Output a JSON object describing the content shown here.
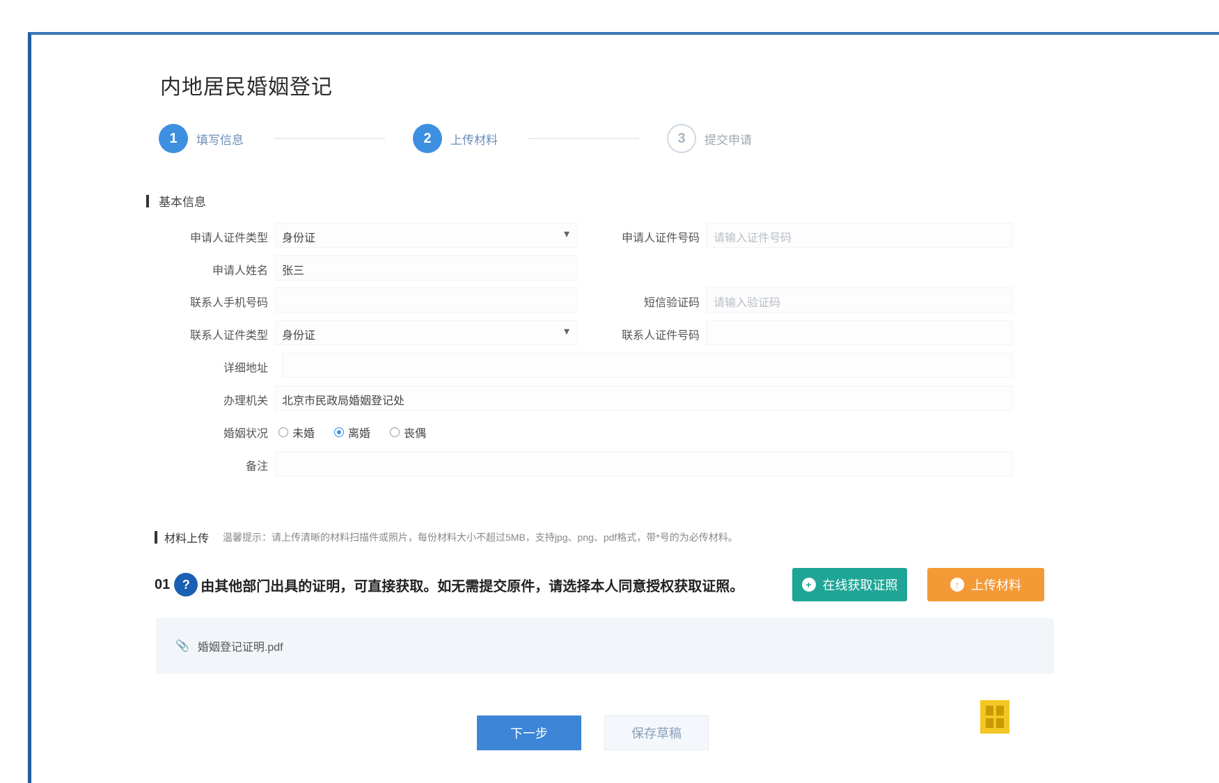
{
  "page": {
    "title": "内地居民婚姻登记"
  },
  "steps": [
    {
      "num": "1",
      "label": "填写信息",
      "state": "done"
    },
    {
      "num": "2",
      "label": "上传材料",
      "state": "done"
    },
    {
      "num": "3",
      "label": "提交申请",
      "state": "pending"
    }
  ],
  "section_basic": {
    "title": "基本信息"
  },
  "form": {
    "applicant_id_type": {
      "label": "申请人证件类型",
      "value": "身份证"
    },
    "applicant_id_no": {
      "label": "申请人证件号码",
      "placeholder": "请输入证件号码"
    },
    "applicant_name": {
      "label": "申请人姓名",
      "value": "张三"
    },
    "applicant_phone": {
      "label": "联系人手机号码",
      "value": ""
    },
    "phone_code": {
      "label": "短信验证码",
      "placeholder": "请输入验证码"
    },
    "contact_id_type": {
      "label": "联系人证件类型",
      "value": "身份证"
    },
    "contact_id_no": {
      "label": "联系人证件号码",
      "value": ""
    },
    "address": {
      "label": "详细地址",
      "value": ""
    },
    "agency": {
      "label": "办理机关",
      "value": "北京市民政局婚姻登记处"
    },
    "marital": {
      "label": "婚姻状况",
      "options": [
        {
          "text": "未婚",
          "selected": false
        },
        {
          "text": "离婚",
          "selected": true
        },
        {
          "text": "丧偶",
          "selected": false
        }
      ]
    },
    "remark": {
      "label": "备注",
      "value": ""
    }
  },
  "materials": {
    "title": "材料上传",
    "note": "温馨提示：请上传清晰的材料扫描件或照片，每份材料大小不超过5MB，支持jpg、png、pdf格式，带*号的为必传材料。",
    "item": {
      "index": "01",
      "badge": "?",
      "text": "由其他部门出具的证明，可直接获取。如无需提交原件，请选择本人同意授权获取证照。"
    },
    "btn_online": "在线获取证照",
    "btn_upload": "上传材料",
    "file_name": "婚姻登记证明.pdf"
  },
  "actions": {
    "next": "下一步",
    "save": "保存草稿"
  },
  "colors": {
    "primary": "#3d85d6",
    "green": "#1fa596",
    "orange": "#f39a37",
    "frame": "#1f5f9e"
  }
}
